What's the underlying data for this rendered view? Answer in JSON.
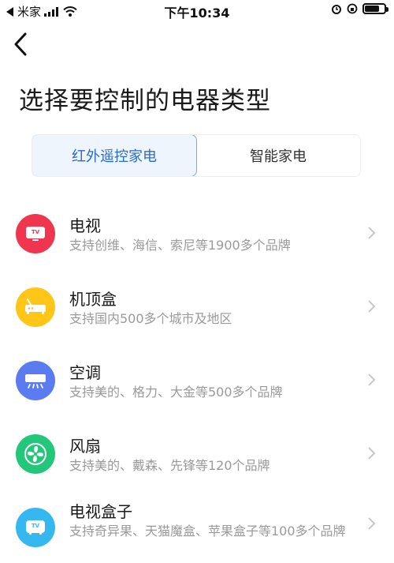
{
  "status": {
    "carrier": "米家",
    "time": "下午10:34",
    "battery_level": 0.8
  },
  "header": {
    "title": "选择要控制的电器类型"
  },
  "tabs": [
    {
      "label": "红外遥控家电",
      "active": true
    },
    {
      "label": "智能家电",
      "active": false
    }
  ],
  "devices": [
    {
      "title": "电视",
      "subtitle": "支持创维、海信、索尼等1900多个品牌",
      "icon": "tv-icon",
      "color": "#f0364f",
      "icon_text": "TV"
    },
    {
      "title": "机顶盒",
      "subtitle": "支持国内500多个城市及地区",
      "icon": "set-top-box-icon",
      "color": "#ffc517"
    },
    {
      "title": "空调",
      "subtitle": "支持美的、格力、大金等500多个品牌",
      "icon": "air-conditioner-icon",
      "color": "#5b7cf1"
    },
    {
      "title": "风扇",
      "subtitle": "支持美的、戴森、先锋等120个品牌",
      "icon": "fan-icon",
      "color": "#22c77a"
    },
    {
      "title": "电视盒子",
      "subtitle": "支持奇异果、天猫魔盒、苹果盒子等100多个品牌",
      "icon": "tv-box-icon",
      "color": "#35b8f0",
      "icon_text": "TV"
    }
  ]
}
